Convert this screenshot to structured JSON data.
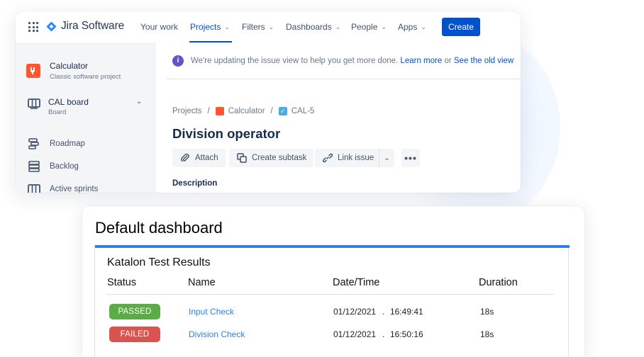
{
  "nav": {
    "app_name": "Jira Software",
    "items": [
      {
        "label": "Your work",
        "has_dropdown": false,
        "active": false
      },
      {
        "label": "Projects",
        "has_dropdown": true,
        "active": true
      },
      {
        "label": "Filters",
        "has_dropdown": true,
        "active": false
      },
      {
        "label": "Dashboards",
        "has_dropdown": true,
        "active": false
      },
      {
        "label": "People",
        "has_dropdown": true,
        "active": false
      },
      {
        "label": "Apps",
        "has_dropdown": true,
        "active": false
      }
    ],
    "create_label": "Create",
    "accent_color": "#0052cc"
  },
  "sidebar": {
    "project_name": "Calculator",
    "project_type": "Classic software project",
    "board_title": "CAL board",
    "board_subtitle": "Board",
    "items": [
      {
        "label": "Roadmap",
        "icon": "roadmap-icon"
      },
      {
        "label": "Backlog",
        "icon": "backlog-icon"
      },
      {
        "label": "Active sprints",
        "icon": "board-columns-icon"
      }
    ]
  },
  "banner": {
    "text": "We're updating the issue view to help you get more done.",
    "learn_more": "Learn more",
    "or": "or",
    "old_view": "See the old view"
  },
  "issue": {
    "breadcrumb": [
      "Projects",
      "Calculator",
      "CAL-5"
    ],
    "title": "Division operator",
    "actions": [
      "Attach",
      "Create subtask",
      "Link issue"
    ],
    "description_label": "Description"
  },
  "dashboard": {
    "title": "Default dashboard",
    "gadget_title": "Katalon Test Results",
    "columns": [
      "Status",
      "Name",
      "Date/Time",
      "Duration"
    ],
    "rows": [
      {
        "status": "PASSED",
        "status_color": "#5aac44",
        "name": "Input Check",
        "date": "01/12/2021",
        "sep": ".",
        "time": "16:49:41",
        "duration": "18s"
      },
      {
        "status": "FAILED",
        "status_color": "#d9534f",
        "name": "Division Check",
        "date": "01/12/2021",
        "sep": ".",
        "time": "16:50:16",
        "duration": "18s"
      }
    ]
  }
}
